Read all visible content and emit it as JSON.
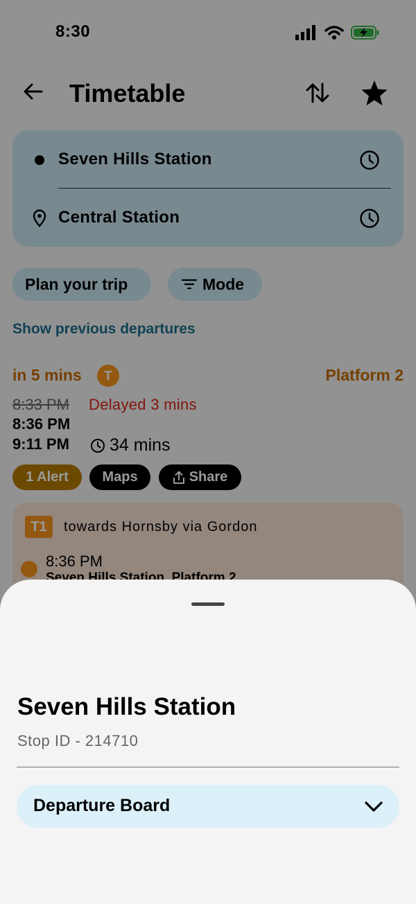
{
  "status_bar": {
    "time": "8:30"
  },
  "header": {
    "title": "Timetable"
  },
  "trip": {
    "origin": "Seven Hills Station",
    "destination": "Central Station"
  },
  "filters": {
    "plan_label": "Plan your trip",
    "mode_label": "Mode"
  },
  "previous_link": "Show previous departures",
  "departure": {
    "in_mins": "in 5 mins",
    "mode_badge": "T",
    "platform": "Platform 2",
    "scheduled": "8:33 PM",
    "delay": "Delayed 3 mins",
    "depart": "8:36 PM",
    "arrive": "9:11 PM",
    "duration": "34 mins",
    "alert_label": "1 Alert",
    "maps_label": "Maps",
    "share_label": "Share"
  },
  "leg": {
    "line": "T1",
    "towards": "towards Hornsby via Gordon",
    "time": "8:36 PM",
    "stop": "Seven Hills Station, Platform 2"
  },
  "sheet": {
    "title": "Seven Hills Station",
    "stop_id": "Stop ID - 214710",
    "dropdown_label": "Departure Board"
  },
  "colors": {
    "accent_orange": "#f7941d",
    "link_blue": "#1c6e8a",
    "delay_red": "#d9251c",
    "card_blue": "#c8e7f1"
  }
}
